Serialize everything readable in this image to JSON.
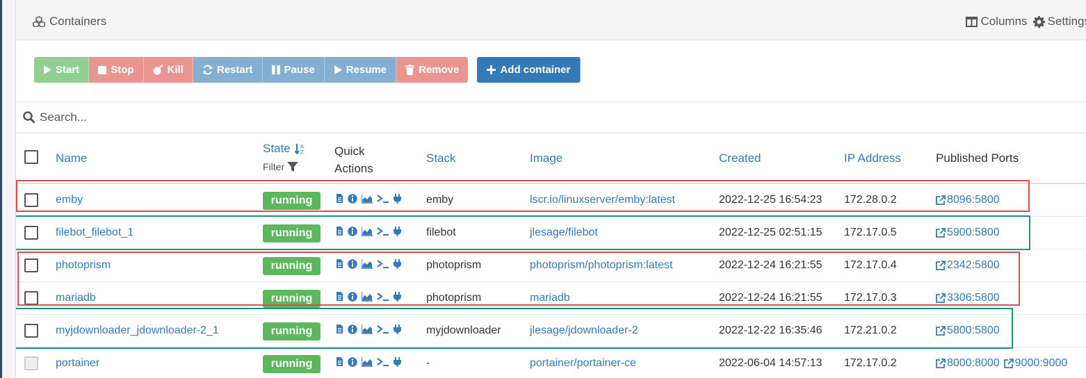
{
  "header": {
    "title": "Containers",
    "columns_label": "Columns",
    "settings_label": "Settings"
  },
  "toolbar": {
    "start": "Start",
    "stop": "Stop",
    "kill": "Kill",
    "restart": "Restart",
    "pause": "Pause",
    "resume": "Resume",
    "remove": "Remove",
    "add": "Add container"
  },
  "search": {
    "placeholder": "Search..."
  },
  "columns": {
    "name": "Name",
    "state": "State",
    "filter": "Filter",
    "quick1": "Quick",
    "quick2": "Actions",
    "stack": "Stack",
    "image": "Image",
    "created": "Created",
    "ip": "IP Address",
    "ports": "Published Ports"
  },
  "rows": [
    {
      "name": "emby",
      "state": "running",
      "stack": "emby",
      "image": "lscr.io/linuxserver/emby:latest",
      "created": "2022-12-25 16:54:23",
      "ip": "172.28.0.2",
      "ports": [
        "8096:5800"
      ]
    },
    {
      "name": "filebot_filebot_1",
      "state": "running",
      "stack": "filebot",
      "image": "jlesage/filebot",
      "created": "2022-12-25 02:51:15",
      "ip": "172.17.0.5",
      "ports": [
        "5900:5800"
      ]
    },
    {
      "name": "photoprism",
      "state": "running",
      "stack": "photoprism",
      "image": "photoprism/photoprism:latest",
      "created": "2022-12-24 16:21:55",
      "ip": "172.17.0.4",
      "ports": [
        "2342:5800"
      ]
    },
    {
      "name": "mariadb",
      "state": "running",
      "stack": "photoprism",
      "image": "mariadb",
      "created": "2022-12-24 16:21:55",
      "ip": "172.17.0.3",
      "ports": [
        "3306:5800"
      ]
    },
    {
      "name": "myjdownloader_jdownloader-2_1",
      "state": "running",
      "stack": "myjdownloader",
      "image": "jlesage/jdownloader-2",
      "created": "2022-12-22 16:35:46",
      "ip": "172.21.0.2",
      "ports": [
        "5800:5800"
      ]
    },
    {
      "name": "portainer",
      "state": "running",
      "stack": "-",
      "image": "portainer/portainer-ce",
      "created": "2022-06-04 14:57:13",
      "ip": "172.17.0.2",
      "ports": [
        "8000:8000",
        "9000:9000"
      ]
    }
  ],
  "colors": {
    "primary": "#337ab7",
    "running": "#5cb85c",
    "highlight_red": "#e04a4a",
    "highlight_green": "#18937d"
  }
}
